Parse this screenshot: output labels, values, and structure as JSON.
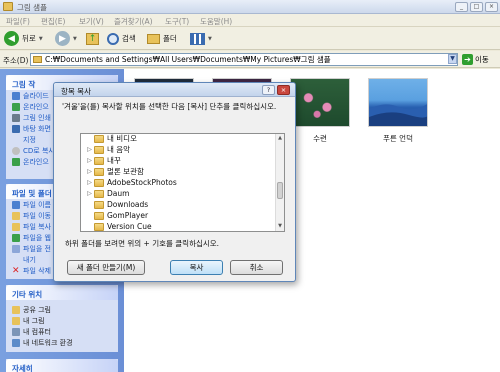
{
  "window": {
    "title": "그림 샘플",
    "controls": [
      "_",
      "□",
      "×"
    ]
  },
  "menu": [
    "파일(F)",
    "편집(E)",
    "보기(V)",
    "즐겨찾기(A)",
    "도구(T)",
    "도움말(H)"
  ],
  "toolbar": {
    "back_label": "뒤로",
    "search_label": "검색",
    "folders_label": "폴더"
  },
  "address": {
    "label": "주소(D)",
    "value": "C:₩Documents and Settings₩All Users₩Documents₩My Pictures₩그림 샘플",
    "go_label": "이동"
  },
  "sidebar": {
    "picture_tasks": {
      "header": "그림 작",
      "items": [
        "슬라이드",
        "온라인으",
        "그림 인쇄",
        "바탕 화면",
        "지정",
        "CD로 복사",
        "온라인으"
      ]
    },
    "file_tasks": {
      "header": "파일 및 폴더",
      "items": [
        "파일 이름",
        "파일 이동",
        "파일 복사",
        "파일을 웹",
        "파일을 전",
        "내기",
        "파일 삭제"
      ]
    },
    "other_places": {
      "header": "기타 위치",
      "items": [
        "공유 그림",
        "내 그림",
        "내 컴퓨터",
        "내 네트워크 환경"
      ]
    },
    "details": {
      "header": "자세히"
    }
  },
  "content": {
    "thumbnails": [
      {
        "caption": "수련"
      },
      {
        "caption": "푸른 언덕"
      }
    ]
  },
  "dialog": {
    "title": "항목 복사",
    "help_btn": "?",
    "close_btn": "×",
    "instruction": "'겨울'을(를) 복사할 위치를 선택한 다음 [복사] 단추를 클릭하십시오.",
    "tree": [
      {
        "label": "내 비디오",
        "expander": ""
      },
      {
        "label": "내 음악",
        "expander": "▷"
      },
      {
        "label": "내꾸",
        "expander": "▷"
      },
      {
        "label": "멀론 보관함",
        "expander": "▷"
      },
      {
        "label": "AdobeStockPhotos",
        "expander": "▷"
      },
      {
        "label": "Daum",
        "expander": "▷"
      },
      {
        "label": "Downloads",
        "expander": ""
      },
      {
        "label": "GomPlayer",
        "expander": ""
      },
      {
        "label": "Version Cue",
        "expander": ""
      }
    ],
    "hint": "하위 폴더를 보려면 위의 + 기호를 클릭하십시오.",
    "new_folder_btn": "새 폴더 만들기(M)",
    "copy_btn": "복사",
    "cancel_btn": "취소"
  }
}
